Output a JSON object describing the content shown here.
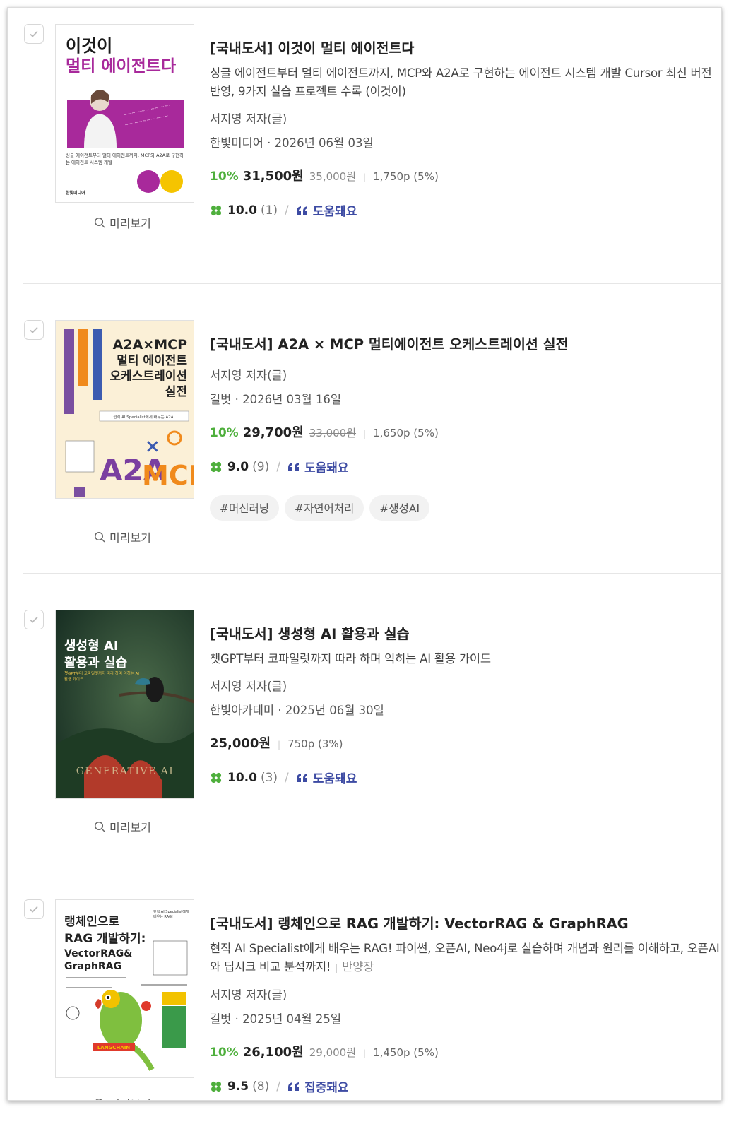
{
  "items": [
    {
      "title": "[국내도서] 이것이 멀티 에이전트다",
      "desc": "싱글 에이전트부터 멀티 에이전트까지, MCP와 A2A로 구현하는 에이전트 시스템 개발 Cursor 최신 버전 반영, 9가지 실습 프로젝트 수록 (이것이)",
      "author": "서지영 저자(글)",
      "pub": "한빛미디어 · 2026년 06월 03일",
      "discount": "10%",
      "price": "31,500원",
      "orig": "35,000원",
      "point": "1,750p (5%)",
      "score": "10.0",
      "count": "(1)",
      "review": "도움돼요",
      "preview": "미리보기",
      "cover": {
        "line1": "이것이",
        "line2": "멀티 에이전트다",
        "sub": "싱글 에이전트부터 멀티 에이전트까지, MCP와 A2A로 구현하는 에이전트 시스템 개발",
        "pub": "한빛미디어"
      }
    },
    {
      "title": "[국내도서] A2A × MCP 멀티에이전트 오케스트레이션 실전",
      "author": "서지영 저자(글)",
      "pub": "길벗 · 2026년 03월 16일",
      "discount": "10%",
      "price": "29,700원",
      "orig": "33,000원",
      "point": "1,650p (5%)",
      "score": "9.0",
      "count": "(9)",
      "review": "도움돼요",
      "preview": "미리보기",
      "tags": [
        "#머신러닝",
        "#자연어처리",
        "#생성AI"
      ],
      "cover": {
        "line1": "A2A×MCP",
        "line2": "멀티 에이전트",
        "line3": "오케스트레이션",
        "line4": "실전",
        "strip": "현직 AI Specialist에게 배우는 A2A!",
        "big1": "A2A",
        "big2": "MCP"
      }
    },
    {
      "title": "[국내도서] 생성형 AI 활용과 실습",
      "desc": "챗GPT부터 코파일럿까지 따라 하며 익히는 AI 활용 가이드",
      "author": "서지영 저자(글)",
      "pub": "한빛아카데미 · 2025년 06월 30일",
      "price": "25,000원",
      "point": "750p (3%)",
      "score": "10.0",
      "count": "(3)",
      "review": "도움돼요",
      "preview": "미리보기",
      "cover": {
        "line1": "생성형 AI",
        "line2": "활용과 실습",
        "sub": "챗GPT부터 코파일럿까지 따라 하며 익히는 AI 활용 가이드",
        "bottom": "GENERATIVE AI"
      }
    },
    {
      "title": "[국내도서] 랭체인으로 RAG 개발하기: VectorRAG & GraphRAG",
      "desc": "현직 AI Specialist에게 배우는 RAG! 파이썬, 오픈AI, Neo4j로 실습하며 개념과 원리를 이해하고, 오픈AI와 딥시크 비교 분석까지!",
      "desc_extra": "반양장",
      "author": "서지영 저자(글)",
      "pub": "길벗 · 2025년 04월 25일",
      "discount": "10%",
      "price": "26,100원",
      "orig": "29,000원",
      "point": "1,450p (5%)",
      "score": "9.5",
      "count": "(8)",
      "review": "집중돼요",
      "preview": "미리보기",
      "cover": {
        "line1": "랭체인으로",
        "line2": "RAG 개발하기:",
        "line3": "VectorRAG&",
        "line4": "GraphRAG",
        "side": "현직 AI Specialist에게 배우는 RAG!",
        "badge": "LANGCHAIN"
      }
    }
  ],
  "colors": {
    "discount": "#4eaf3c",
    "review": "#3d4ba3",
    "clover": "#4eaf3c"
  }
}
